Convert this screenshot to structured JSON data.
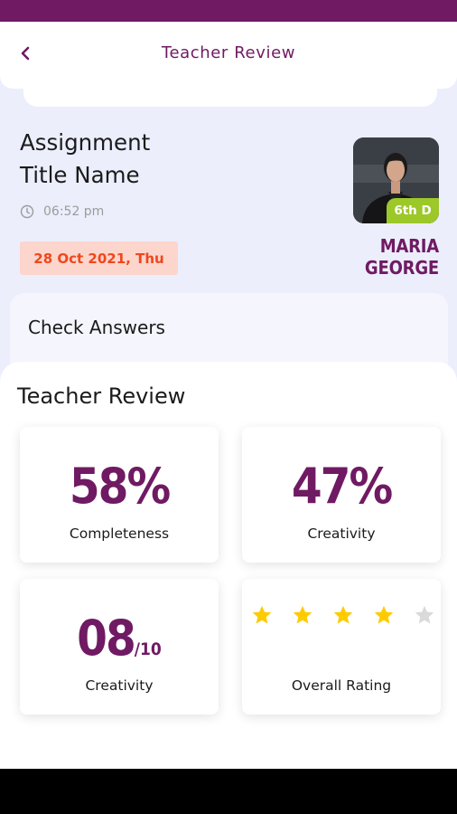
{
  "header": {
    "title": "Teacher Review"
  },
  "assignment": {
    "title_line1": "Assignment",
    "title_line2": "Title Name",
    "time": "06:52 pm",
    "date": "28 Oct 2021, Thu"
  },
  "student": {
    "name": "MARIA GEORGE",
    "grade": "6th D"
  },
  "check_answers": {
    "label": "Check Answers"
  },
  "review": {
    "heading": "Teacher Review",
    "tiles": [
      {
        "value": "58%",
        "label": "Completeness"
      },
      {
        "value": "47%",
        "label": "Creativity"
      },
      {
        "value": "08",
        "value_suffix": "/10",
        "label": "Creativity"
      },
      {
        "label": "Overall Rating",
        "rating": 4,
        "rating_max": 5
      }
    ]
  },
  "colors": {
    "brand": "#6f1a63",
    "star": "#fecb00",
    "star_empty": "#dadada",
    "badge": "#9cc82a",
    "date_text": "#f0471d",
    "date_bg": "#fcd5cc"
  }
}
